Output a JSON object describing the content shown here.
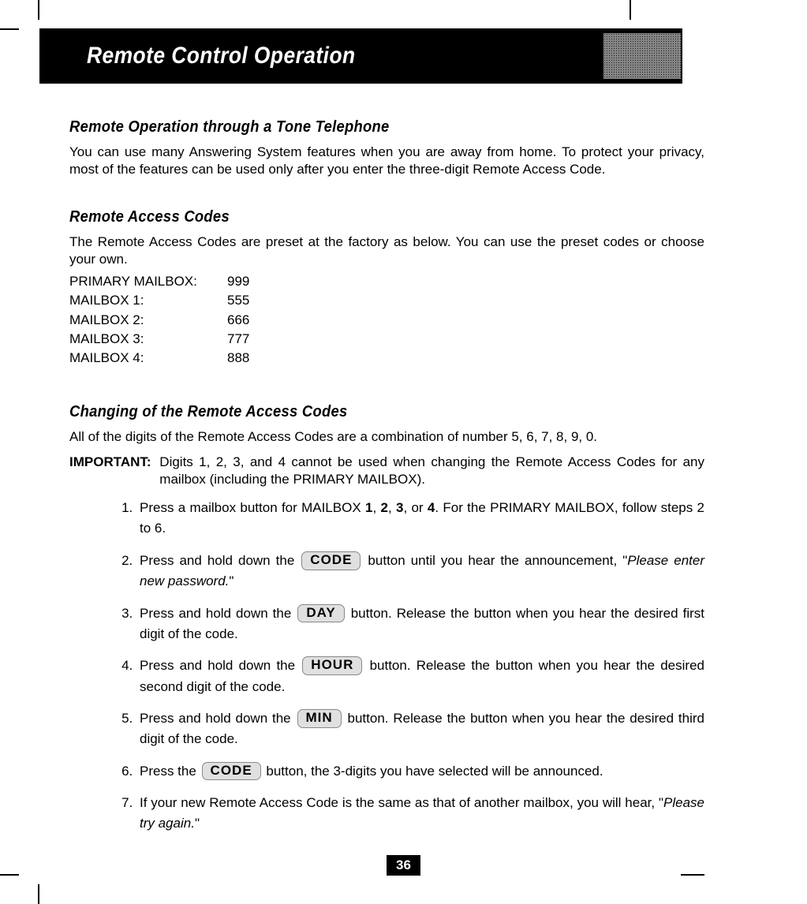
{
  "header": {
    "title": "Remote Control Operation"
  },
  "section1": {
    "title": "Remote Operation through a Tone Telephone",
    "text": "You can use many Answering System features when you are away from home. To protect your privacy, most of the features can be used only after you enter the three-digit Remote Access Code."
  },
  "section2": {
    "title": "Remote Access Codes",
    "intro": "The Remote Access Codes are preset at the factory as below. You can use the preset codes or choose your own.",
    "codes": [
      {
        "label": "PRIMARY MAILBOX:",
        "value": "999"
      },
      {
        "label": "MAILBOX 1:",
        "value": "555"
      },
      {
        "label": "MAILBOX 2:",
        "value": "666"
      },
      {
        "label": "MAILBOX 3:",
        "value": "777"
      },
      {
        "label": "MAILBOX 4:",
        "value": "888"
      }
    ]
  },
  "section3": {
    "title": "Changing of the Remote Access Codes",
    "combo": "All of the digits of the Remote Access Codes are a combination of number 5, 6, 7, 8, 9, 0.",
    "important_label": "IMPORTANT",
    "important_text": "Digits 1, 2, 3, and 4 cannot be used when changing the Remote Access Codes for any mailbox (including the PRIMARY MAILBOX).",
    "steps": {
      "s1_a": "Press a mailbox button for MAILBOX ",
      "s1_b1": "1",
      "s1_c": ", ",
      "s1_b2": "2",
      "s1_d": ", ",
      "s1_b3": "3",
      "s1_e": ", or ",
      "s1_b4": "4",
      "s1_f": ". For the PRIMARY MAILBOX, follow steps 2 to 6.",
      "s2_a": "Press and hold down the ",
      "s2_btn": "CODE",
      "s2_b": " button until you hear the announcement, \"",
      "s2_em": "Please enter new password.",
      "s2_c": "\"",
      "s3_a": "Press and hold down the ",
      "s3_btn": "DAY",
      "s3_b": " button. Release the button when you hear the desired first digit of the code.",
      "s4_a": "Press and hold down the ",
      "s4_btn": "HOUR",
      "s4_b": " button. Release the button when you hear the desired second digit of the code.",
      "s5_a": "Press and hold down the ",
      "s5_btn": "MIN",
      "s5_b": " button. Release the button when you hear the desired third digit of the code.",
      "s6_a": "Press the ",
      "s6_btn": "CODE",
      "s6_b": " button, the 3-digits you have selected will be announced.",
      "s7_a": "If your new Remote Access Code is the same as that of another mailbox, you will hear, \"",
      "s7_em": "Please try again.",
      "s7_b": "\""
    }
  },
  "page_number": "36"
}
